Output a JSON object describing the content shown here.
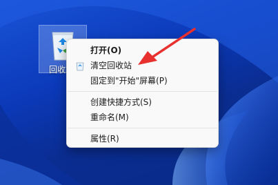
{
  "desktop": {
    "icon_label": "回收站",
    "icon_name": "recycle-bin-icon"
  },
  "context_menu": {
    "items": [
      {
        "label": "打开(O)",
        "bold": true
      },
      {
        "label": "清空回收站",
        "icon": "recycle-bin-small-icon"
      },
      {
        "label": "固定到\"开始\"屏幕(P)"
      },
      {
        "label": "创建快捷方式(S)"
      },
      {
        "label": "重命名(M)"
      },
      {
        "label": "属性(R)"
      }
    ]
  },
  "annotation": {
    "arrow_color": "#e8302e"
  }
}
